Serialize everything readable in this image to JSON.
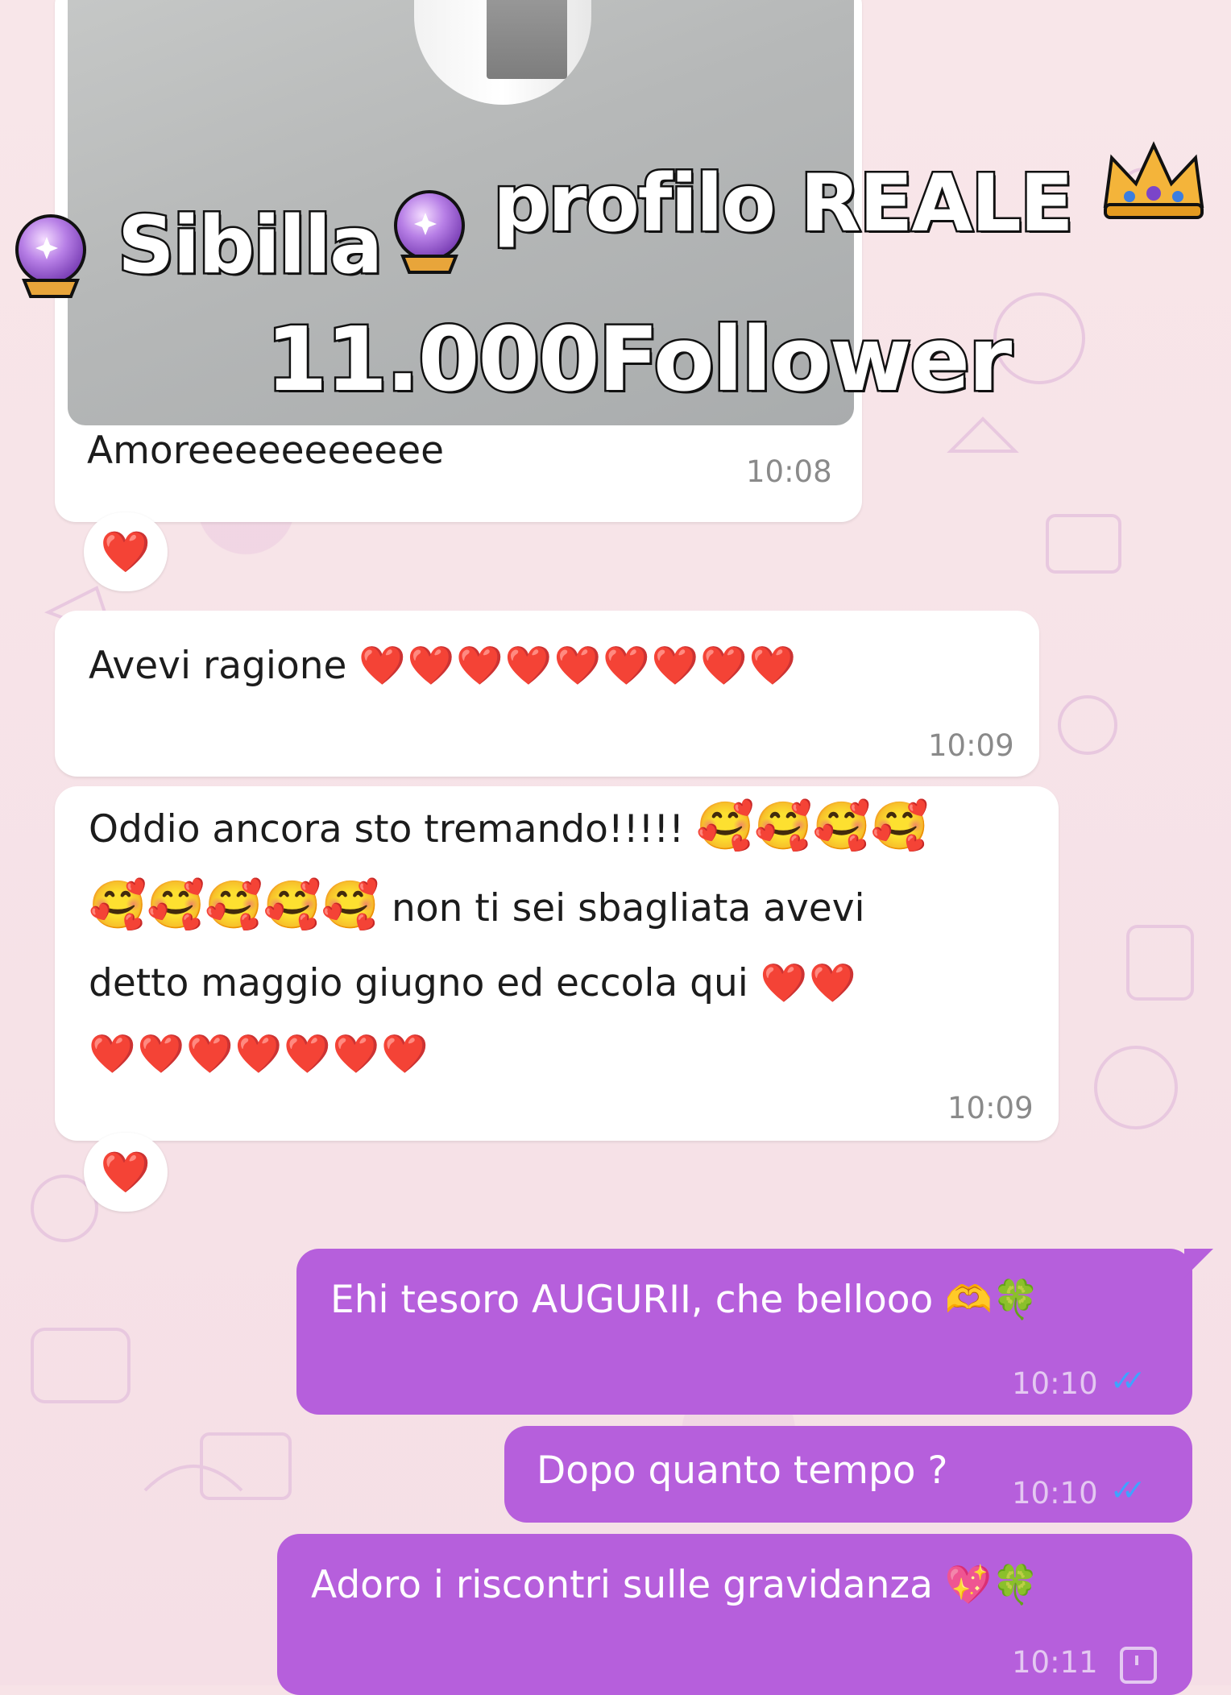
{
  "overlay": {
    "line1_name": "Sibilla",
    "line1_suffix": "profilo REALE",
    "line2": "11.000Follower"
  },
  "messages": {
    "photo": {
      "caption": "Amoreeeeeeeeeee",
      "time": "10:08",
      "reaction": "❤️"
    },
    "msg1": {
      "text": "Avevi ragione",
      "hearts": "❤️❤️❤️❤️❤️❤️❤️❤️❤️",
      "time": "10:09"
    },
    "msg2": {
      "line1_text": "Oddio ancora sto tremando!!!!!",
      "line1_emoji": "🥰🥰🥰🥰",
      "line2_emoji": "🥰🥰🥰🥰🥰",
      "line2_text": "non ti sei sbagliata avevi",
      "line3_text": "detto maggio giugno ed eccola qui",
      "line3_hearts": "❤️❤️",
      "line4_hearts": "❤️❤️❤️❤️❤️❤️❤️",
      "time": "10:09",
      "reaction": "❤️"
    },
    "out1": {
      "text": "Ehi tesoro AUGURII, che bellooo",
      "emoji": "🫶🍀",
      "time": "10:10"
    },
    "out2": {
      "text": "Dopo quanto tempo ?",
      "time": "10:10"
    },
    "out3": {
      "text": "Adoro i riscontri sulle gravidanza",
      "emoji": "💖🍀",
      "time": "10:11"
    }
  },
  "icons": {
    "orb": "crystal-ball-icon",
    "crown": "crown-icon",
    "read": "double-check-icon",
    "pending": "clock-icon"
  },
  "colors": {
    "outgoing_bubble": "#b65fdc",
    "incoming_bubble": "#ffffff",
    "wallpaper": "#f7e3e7",
    "read_ticks": "#3fa3ff"
  }
}
